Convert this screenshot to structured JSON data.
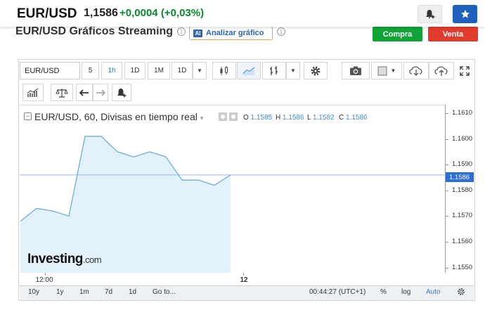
{
  "quote": {
    "pair": "EUR/USD",
    "price": "1,1586",
    "change": "+0,0004",
    "change_pct": "(+0,03%)",
    "change_color": "#0a8a2a",
    "alert_icon": "bell-plus-icon",
    "favorite_icon": "star-icon"
  },
  "subheader": {
    "title": "EUR/USD Gráficos Streaming",
    "analyze_badge": "AI",
    "analyze_label": "Analizar gráfico",
    "buy_label": "Compra",
    "sell_label": "Venta",
    "buy_color": "#10a436",
    "sell_color": "#e23b2d"
  },
  "toolbar": {
    "symbol": "EUR/USD",
    "intervals": [
      "5",
      "1h",
      "1D",
      "1M",
      "1D"
    ],
    "selected_interval": "1h"
  },
  "legend": {
    "title": "EUR/USD, 60, Divisas en tiempo real",
    "ohlc": [
      {
        "k": "O",
        "v": "1.1585"
      },
      {
        "k": "H",
        "v": "1.1586"
      },
      {
        "k": "L",
        "v": "1.1582"
      },
      {
        "k": "C",
        "v": "1.1586"
      }
    ]
  },
  "chart_data": {
    "type": "area",
    "x": [
      0,
      1,
      2,
      3,
      4,
      5,
      6,
      7,
      8,
      9,
      10,
      11,
      12,
      13
    ],
    "values": [
      1.1568,
      1.1573,
      1.1572,
      1.157,
      1.1601,
      1.1601,
      1.1595,
      1.1593,
      1.1595,
      1.1593,
      1.1584,
      1.1584,
      1.1582,
      1.1586
    ],
    "last_price": 1.1586,
    "last_price_label": "1.1586",
    "y_ticks": [
      "1.1610",
      "1.1600",
      "1.1590",
      "1.1580",
      "1.1570",
      "1.1560",
      "1.1550"
    ],
    "y_tick_values": [
      1.161,
      1.16,
      1.159,
      1.158,
      1.157,
      1.156,
      1.155
    ],
    "ylim": [
      1.1548,
      1.1613
    ],
    "x_ticks": [
      {
        "label": "12:00",
        "at": 1.5
      },
      {
        "label": "12",
        "at": 13.8
      }
    ],
    "line_color": "#6aaee0",
    "fill_color": "#e3f1fb",
    "last_line_color": "#9bb6e8",
    "grid": false
  },
  "watermark": {
    "brand": "Investing",
    "suffix": ".com"
  },
  "bottom_bar": {
    "ranges": [
      "10y",
      "1y",
      "1m",
      "7d",
      "1d"
    ],
    "goto": "Go to...",
    "time": "00:44:27 (UTC+1)",
    "percent": "%",
    "log": "log",
    "auto": "Auto"
  }
}
